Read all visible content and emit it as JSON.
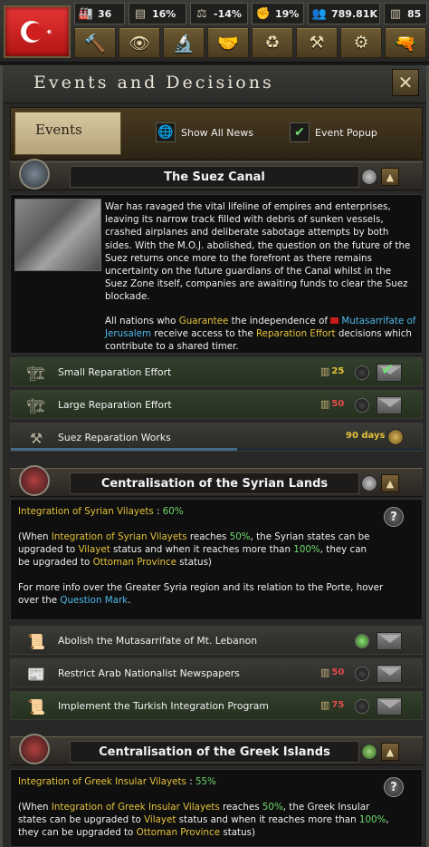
{
  "topbar": {
    "resources": [
      {
        "icon": "factory-icon",
        "glyph": "🏭",
        "value": "36"
      },
      {
        "icon": "political-power-icon",
        "glyph": "▤",
        "value": "16%"
      },
      {
        "icon": "stability-icon",
        "glyph": "⚖",
        "value": "-14%"
      },
      {
        "icon": "war-support-icon",
        "glyph": "✊",
        "value": "19%"
      },
      {
        "icon": "manpower-icon",
        "glyph": "👥",
        "value": "789.81K"
      },
      {
        "icon": "convoys-icon",
        "glyph": "▥",
        "value": "85"
      }
    ],
    "tools": [
      {
        "icon": "decisions-hammer-icon",
        "glyph": "🔨"
      },
      {
        "icon": "intelligence-eye-icon",
        "glyph": "👁"
      },
      {
        "icon": "research-icon",
        "glyph": "🔬"
      },
      {
        "icon": "diplomacy-handshake-icon",
        "glyph": "🤝"
      },
      {
        "icon": "trade-icon",
        "glyph": "♻"
      },
      {
        "icon": "construction-icon",
        "glyph": "⚒"
      },
      {
        "icon": "production-gear-icon",
        "glyph": "⚙"
      },
      {
        "icon": "army-icon",
        "glyph": "🔫"
      }
    ]
  },
  "panel": {
    "title": "Events and Decisions",
    "close_glyph": "✕",
    "tab_label": "Events",
    "show_all_news": "Show All News",
    "event_popup": "Event Popup"
  },
  "suez": {
    "title": "The Suez Canal",
    "text1": "War has ravaged the vital lifeline of empires and enterprises, leaving its narrow track filled with debris of sunken vessels, crashed airplanes and deliberate sabotage attempts by both sides. With the M.O.J. abolished, the question on the future of the Suez returns once more to the forefront as there remains uncertainty on the future guardians of the Canal whilst in the Suez Zone itself, companies are awaiting funds to clear the Suez blockade.",
    "text2_a": "All nations who ",
    "text2_b": "Guarantee",
    "text2_c": " the independence of ",
    "text2_d": "Mutasarrifate of Jerusalem",
    "text2_e": " receive access to the ",
    "text2_f": "Reparation Effort",
    "text2_g": " decisions which contribute to a shared timer.",
    "decisions": [
      {
        "name": "Small Reparation Effort",
        "cost": "25"
      },
      {
        "name": "Large Reparation Effort",
        "cost": "50"
      },
      {
        "name": "Suez Reparation Works",
        "days": "90 days"
      }
    ]
  },
  "syria": {
    "title": "Centralisation of the Syrian Lands",
    "progress_label": "Integration of Syrian Vilayets",
    "progress_sep": " : ",
    "progress_value": "60%",
    "p1": "(When ",
    "p2": "Integration of Syrian Vilayets",
    "p3": " reaches ",
    "p4": "50%",
    "p5": ", the Syrian states can be upgraded to ",
    "p6": "Vilayet",
    "p7": " status and when it reaches more than ",
    "p8": "100%",
    "p9": ", they can be upgraded to ",
    "p10": "Ottoman Province",
    "p11": " status)",
    "q1": "For more info over the Greater Syria region and its relation to the Porte, hover over the ",
    "q2": "Question Mark",
    "q3": ".",
    "decisions": [
      {
        "name": "Abolish the Mutasarrifate of Mt. Lebanon"
      },
      {
        "name": "Restrict Arab Nationalist Newspapers",
        "cost": "50"
      },
      {
        "name": "Implement the Turkish Integration Program",
        "cost": "75"
      }
    ]
  },
  "greek": {
    "title": "Centralisation of the Greek Islands",
    "progress_label": "Integration of Greek Insular Vilayets",
    "progress_sep": " : ",
    "progress_value": "55%",
    "p1": "(When ",
    "p2": "Integration of Greek Insular Vilayets",
    "p3": " reaches ",
    "p4": "50%",
    "p5": ", the Greek Insular states can be upgraded to ",
    "p6": "Vilayet",
    "p7": " status and when it reaches more than ",
    "p8": "100%",
    "p9": ", they can be upgraded to ",
    "p10": "Ottoman Province",
    "p11": " status)"
  },
  "colors": {
    "accent_gold": "#e3c23a",
    "accent_blue": "#4fb8e8",
    "accent_green": "#6ed96e"
  },
  "timer_progress": 0.55
}
